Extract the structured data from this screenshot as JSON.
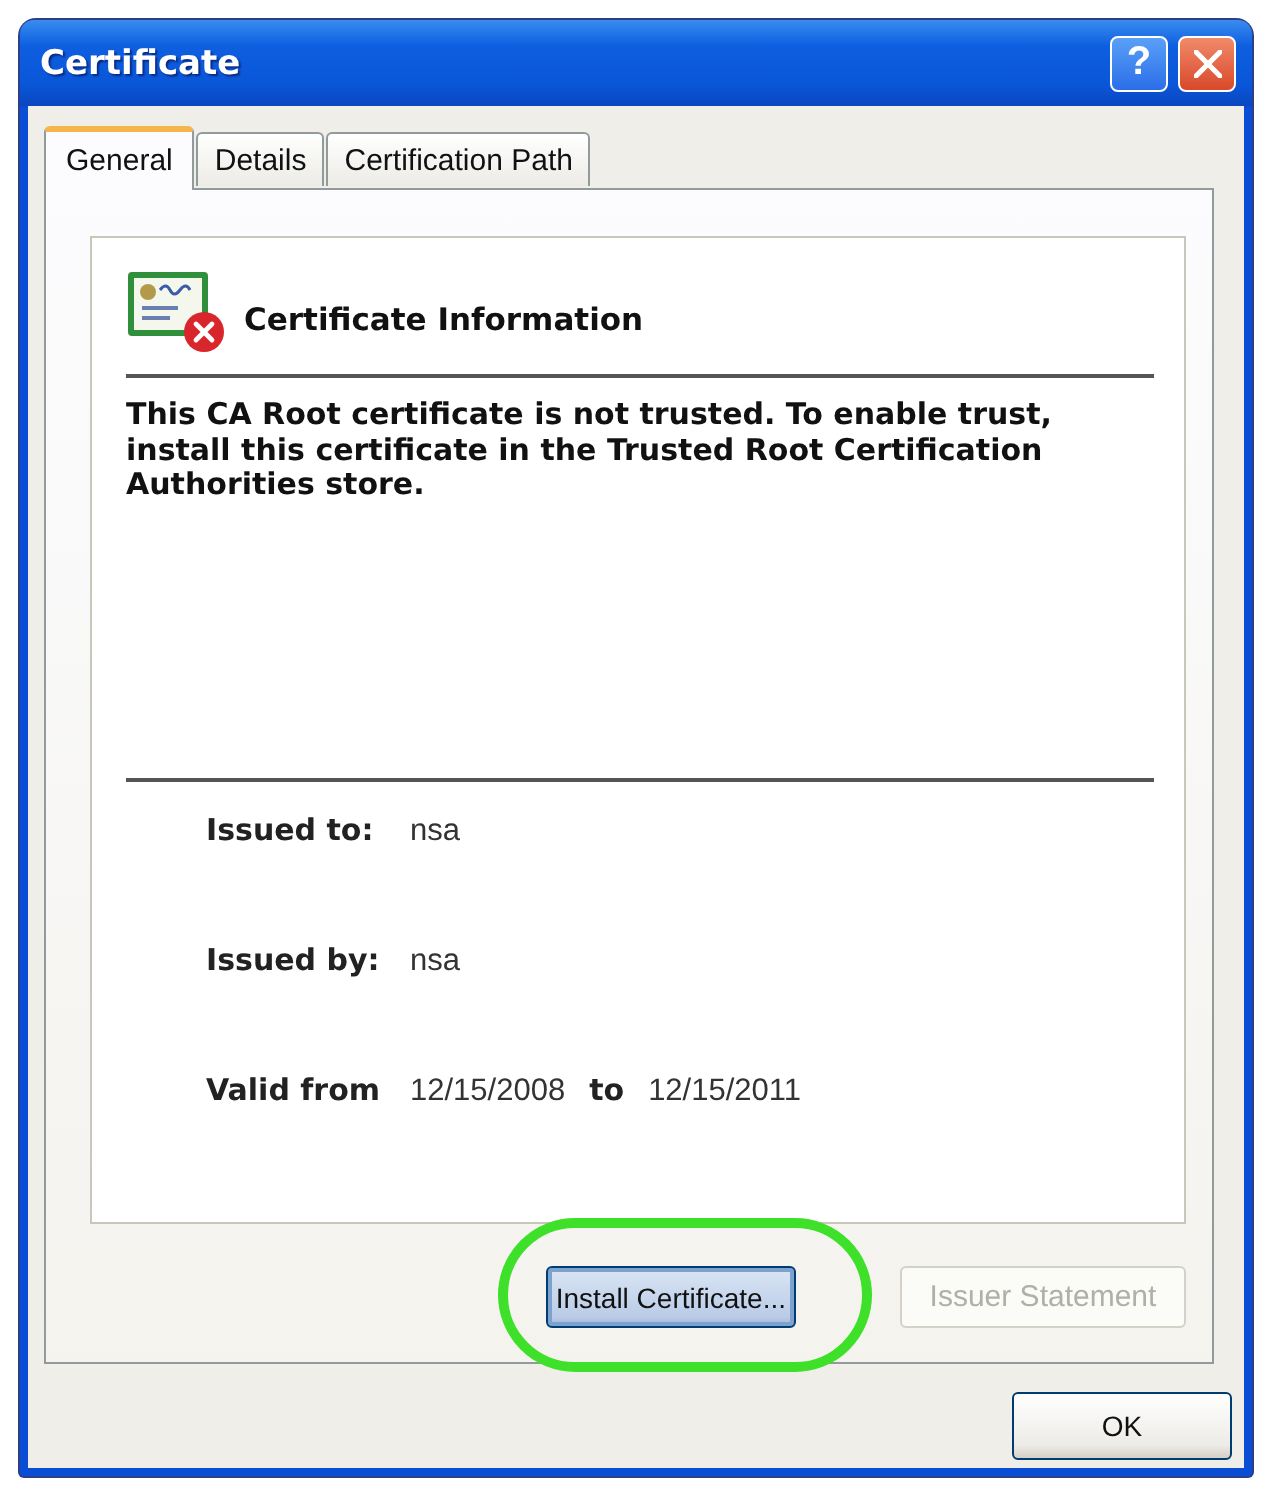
{
  "window": {
    "title": "Certificate",
    "help_button": "?"
  },
  "tabs": [
    {
      "label": "General",
      "selected": true
    },
    {
      "label": "Details",
      "selected": false
    },
    {
      "label": "Certification Path",
      "selected": false
    }
  ],
  "certificate_info": {
    "heading": "Certificate Information",
    "trusted": false,
    "message": "This CA Root certificate is not trusted. To enable trust, install this certificate in the Trusted Root Certification Authorities store.",
    "fields": [
      {
        "kind": "single",
        "label": "Issued to:",
        "value": "nsa"
      },
      {
        "kind": "single",
        "label": "Issued by:",
        "value": "nsa"
      },
      {
        "kind": "range",
        "label": "Valid from",
        "value": "12/15/2008",
        "connector": "to",
        "value_2": "12/15/2011"
      }
    ]
  },
  "panel_buttons": [
    {
      "label": "Install Certificate...",
      "disabled": false,
      "focused": true,
      "highlighted": true
    },
    {
      "label": "Issuer Statement",
      "disabled": true,
      "focused": false,
      "highlighted": false
    }
  ],
  "footer_buttons": [
    {
      "label": "OK",
      "disabled": false,
      "focused": false
    }
  ]
}
